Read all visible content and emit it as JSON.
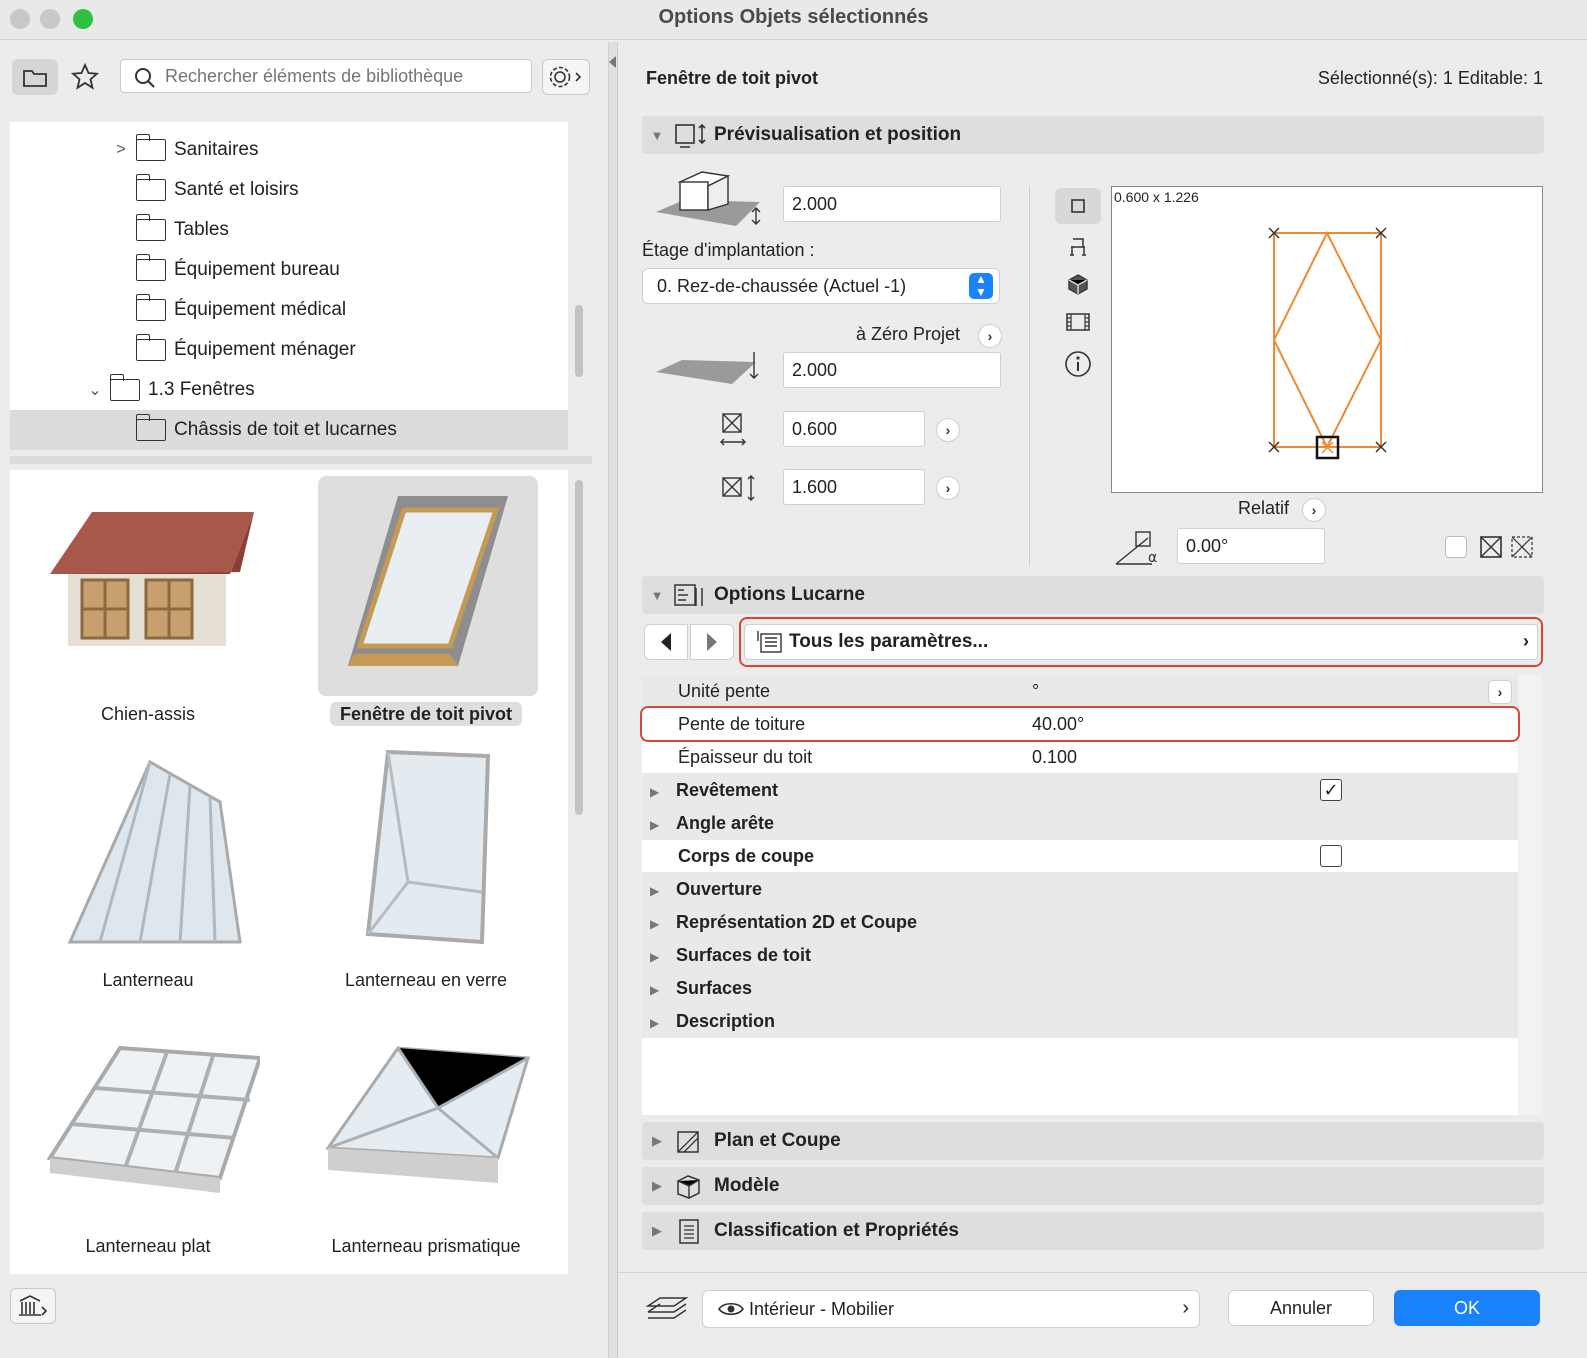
{
  "window": {
    "title": "Options Objets sélectionnés",
    "colors": {
      "close": "#c8c8c8",
      "min": "#c8c8c8",
      "zoom": "#2fc140",
      "accent": "#1a82fb",
      "highlight": "#d9453b",
      "preview_stroke": "#f08a30"
    }
  },
  "library": {
    "search_placeholder": "Rechercher éléments de bibliothèque",
    "tree": [
      {
        "label": "Sanitaires"
      },
      {
        "label": "Santé et loisirs"
      },
      {
        "label": "Tables"
      },
      {
        "label": "Équipement bureau"
      },
      {
        "label": "Équipement médical"
      },
      {
        "label": "Équipement ménager"
      },
      {
        "label": "1.3 Fenêtres"
      },
      {
        "label": "Châssis de toit et lucarnes"
      }
    ],
    "items": [
      {
        "label": "Chien-assis"
      },
      {
        "label": "Fenêtre de toit pivot"
      },
      {
        "label": "Lanterneau"
      },
      {
        "label": "Lanterneau en verre"
      },
      {
        "label": "Lanterneau plat"
      },
      {
        "label": "Lanterneau prismatique"
      }
    ]
  },
  "header": {
    "object_name": "Fenêtre de toit pivot",
    "selection_info": "Sélectionné(s): 1 Editable: 1"
  },
  "preview_position": {
    "title": "Prévisualisation et position",
    "elevation": "2.000",
    "story_label": "Étage d'implantation :",
    "story_value": "0. Rez-de-chaussée (Actuel -1)",
    "zero_label": "à Zéro Projet",
    "offset": "2.000",
    "width": "0.600",
    "height": "1.600",
    "preview_dims": "0.600 x 1.226",
    "relative_label": "Relatif",
    "angle": "0.00°"
  },
  "options": {
    "title": "Options Lucarne",
    "all_params": "Tous les paramètres...",
    "rows": [
      {
        "name": "Unité pente",
        "value": "°"
      },
      {
        "name": "Pente de toiture",
        "value": "40.00°"
      },
      {
        "name": "Épaisseur du toit",
        "value": "0.100"
      },
      {
        "name": "Revêtement",
        "value": ""
      },
      {
        "name": "Angle arête",
        "value": ""
      },
      {
        "name": "Corps de coupe",
        "value": ""
      },
      {
        "name": "Ouverture",
        "value": ""
      },
      {
        "name": "Représentation 2D et Coupe",
        "value": ""
      },
      {
        "name": "Surfaces de toit",
        "value": ""
      },
      {
        "name": "Surfaces",
        "value": ""
      },
      {
        "name": "Description",
        "value": ""
      }
    ]
  },
  "sections": {
    "plan": "Plan et Coupe",
    "model": "Modèle",
    "classification": "Classification et Propriétés"
  },
  "footer": {
    "layer": "Intérieur - Mobilier",
    "cancel": "Annuler",
    "ok": "OK"
  }
}
